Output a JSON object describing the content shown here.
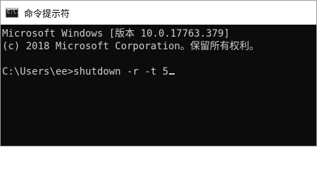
{
  "window": {
    "title": "命令提示符",
    "icon": "cmd-icon",
    "icon_text": "C:\\."
  },
  "console": {
    "lines": [
      "Microsoft Windows [版本 10.0.17763.379]",
      "(c) 2018 Microsoft Corporation。保留所有权利。",
      "",
      "C:\\Users\\ee>shutdown -r -t 5"
    ]
  },
  "colors": {
    "console_bg": "#0c0c0c",
    "console_fg": "#cccccc",
    "titlebar_bg": "#ffffff"
  }
}
